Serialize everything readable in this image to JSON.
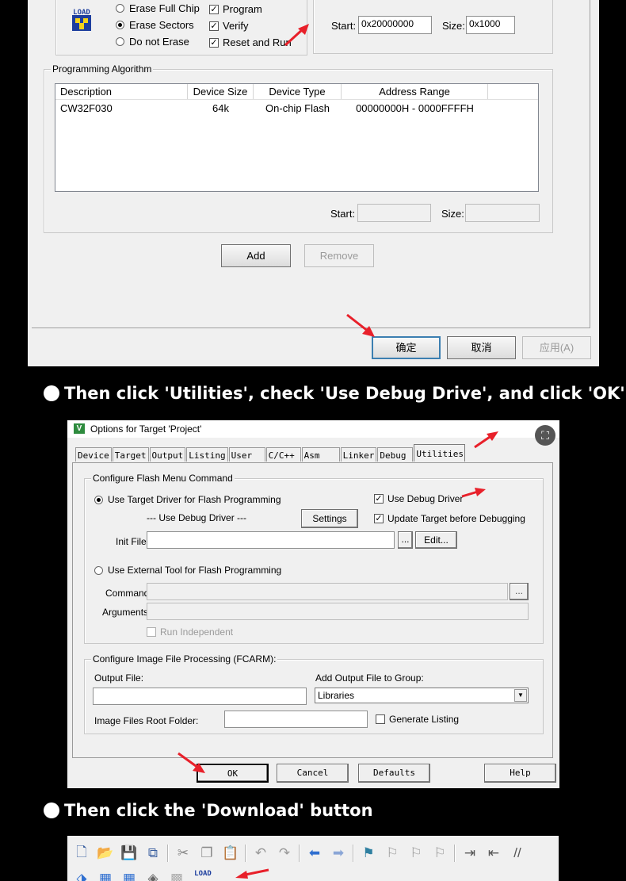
{
  "shot1": {
    "load_icon_label": "LOAD",
    "erase_options": [
      "Erase Full Chip",
      "Erase Sectors",
      "Do not Erase"
    ],
    "erase_selected": 1,
    "program_checks": [
      {
        "label": "Program",
        "checked": true
      },
      {
        "label": "Verify",
        "checked": true
      },
      {
        "label": "Reset and Run",
        "checked": true
      }
    ],
    "ram": {
      "start_label": "Start:",
      "start_value": "0x20000000",
      "size_label": "Size:",
      "size_value": "0x1000"
    },
    "prog_algo": {
      "title": "Programming Algorithm",
      "headers": [
        "Description",
        "Device Size",
        "Device Type",
        "Address Range"
      ],
      "rows": [
        [
          "CW32F030",
          "64k",
          "On-chip Flash",
          "00000000H - 0000FFFFH"
        ]
      ],
      "start_label": "Start:",
      "size_label": "Size:"
    },
    "add_label": "Add",
    "remove_label": "Remove",
    "ok_label": "确定",
    "cancel_label": "取消",
    "apply_label": "应用(A)"
  },
  "caption1": "Then click 'Utilities', check 'Use Debug Drive', and click 'OK'.",
  "shot2": {
    "window_title": "Options for Target 'Project'",
    "tabs": [
      "Device",
      "Target",
      "Output",
      "Listing",
      "User",
      "C/C++",
      "Asm",
      "Linker",
      "Debug",
      "Utilities"
    ],
    "active_tab": "Utilities",
    "flash_group": {
      "title": "Configure Flash Menu Command",
      "use_target_driver": "Use Target Driver for Flash Programming",
      "use_debug_driver_text": "--- Use Debug Driver ---",
      "settings_label": "Settings",
      "use_debug_driver_check": "Use Debug Driver",
      "update_target_check": "Update Target before Debugging",
      "init_file_label": "Init File:",
      "browse_label": "...",
      "edit_label": "Edit...",
      "use_external_tool": "Use External Tool for Flash Programming",
      "command_label": "Command:",
      "arguments_label": "Arguments:",
      "run_independent": "Run Independent"
    },
    "image_group": {
      "title": "Configure Image File Processing (FCARM):",
      "output_file_label": "Output File:",
      "add_output_label": "Add Output File  to Group:",
      "group_value": "Libraries",
      "root_folder_label": "Image Files Root Folder:",
      "generate_listing": "Generate Listing"
    },
    "ok_label": "OK",
    "cancel_label": "Cancel",
    "defaults_label": "Defaults",
    "help_label": "Help"
  },
  "caption2": "Then click the 'Download' button",
  "shot3": {
    "load_label": "LOAD"
  },
  "colors": {
    "arrow": "#e8202a",
    "accent": "#3c7fb1"
  }
}
